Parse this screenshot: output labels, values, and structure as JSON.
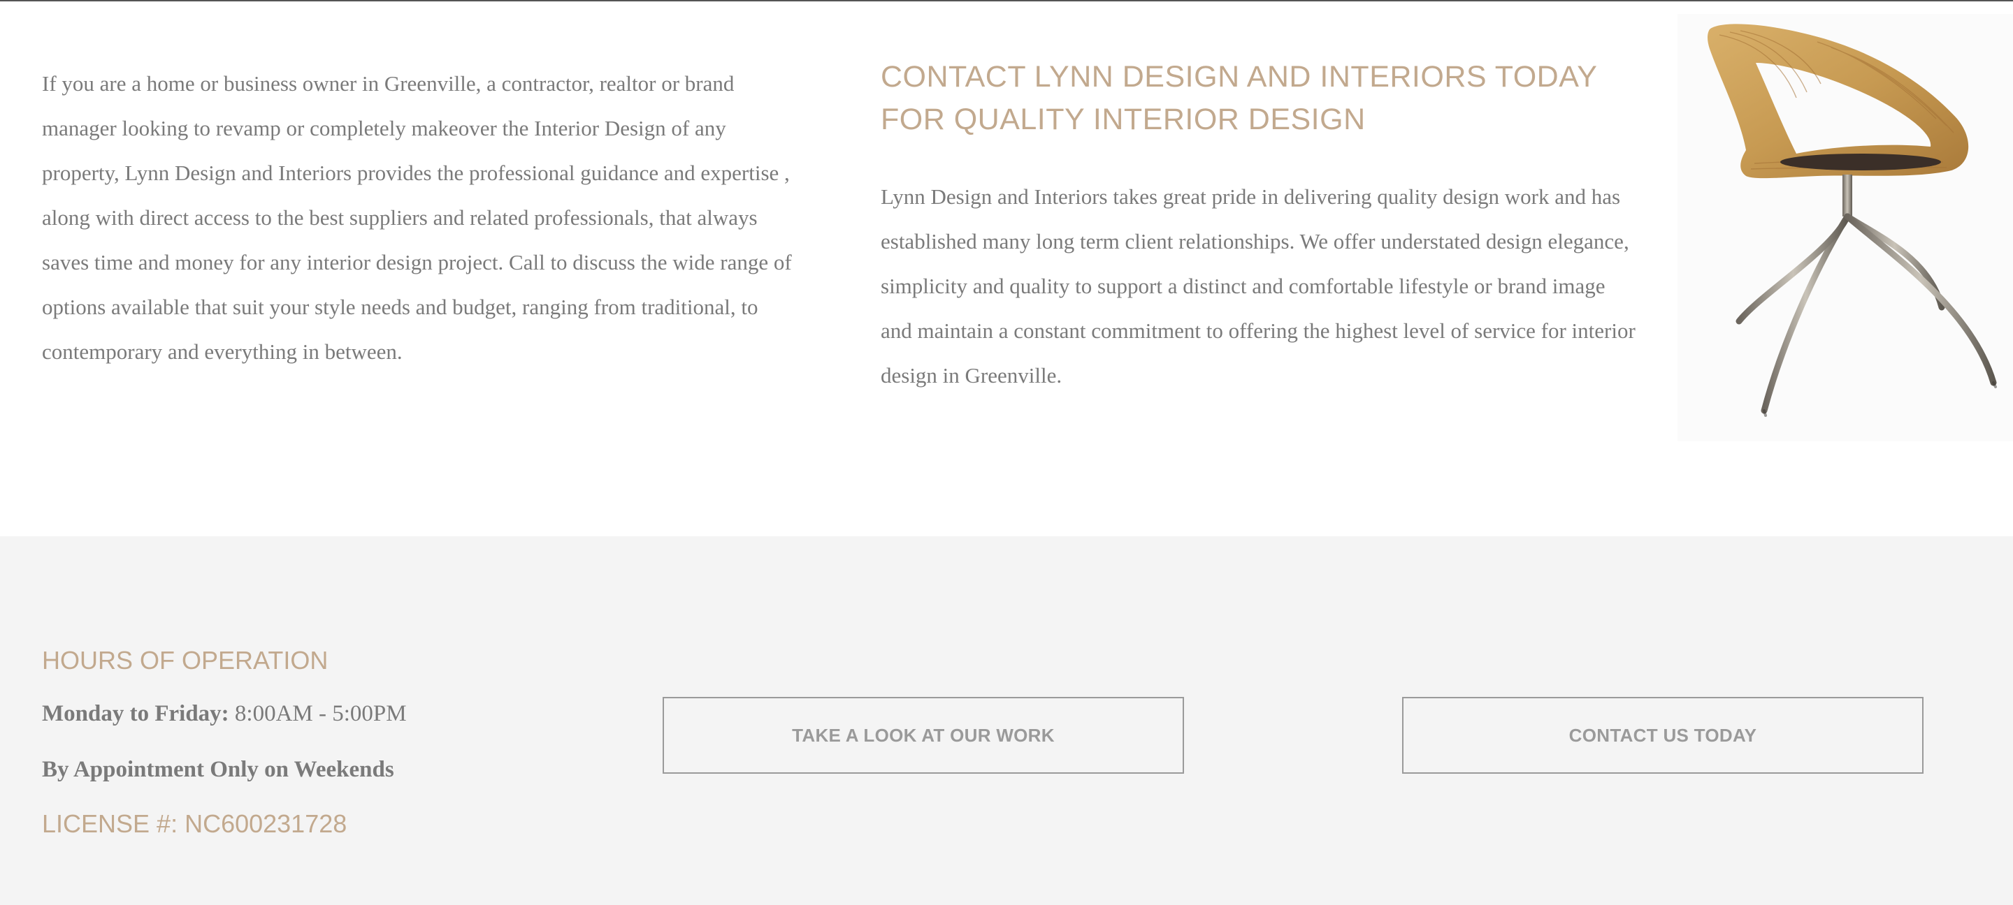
{
  "intro": {
    "text": "If you are a home or business owner in Greenville, a contractor, realtor or brand manager looking to revamp or completely makeover the Interior Design of any property, Lynn Design and Interiors provides the professional guidance and expertise , along with direct access to the best suppliers and related professionals, that always saves time and money for any interior design project. Call to discuss the wide range of options available that suit your style needs and budget, ranging from traditional, to contemporary and everything in between."
  },
  "contact_section": {
    "heading": "CONTACT LYNN DESIGN AND INTERIORS TODAY FOR QUALITY INTERIOR DESIGN",
    "text": "Lynn Design and Interiors takes great pride in delivering quality design work and has established many long term client relationships. We offer understated design elegance, simplicity and quality to support a distinct and comfortable lifestyle or brand image and maintain a constant commitment to offering the highest level of service for interior design in Greenville."
  },
  "footer": {
    "hours_heading": "HOURS OF OPERATION",
    "weekday_label": "Monday to Friday:",
    "weekday_hours": "8:00AM - 5:00PM",
    "weekend_text": "By Appointment Only on Weekends",
    "license": "LICENSE #: NC600231728",
    "buttons": {
      "work_label": "TAKE A LOOK AT OUR WORK",
      "contact_label": "CONTACT US TODAY"
    }
  },
  "colors": {
    "accent": "#c2a98e",
    "body_text": "#7a7a7a",
    "footer_background": "#f4f4f4",
    "button_border": "#9a9a9a"
  }
}
